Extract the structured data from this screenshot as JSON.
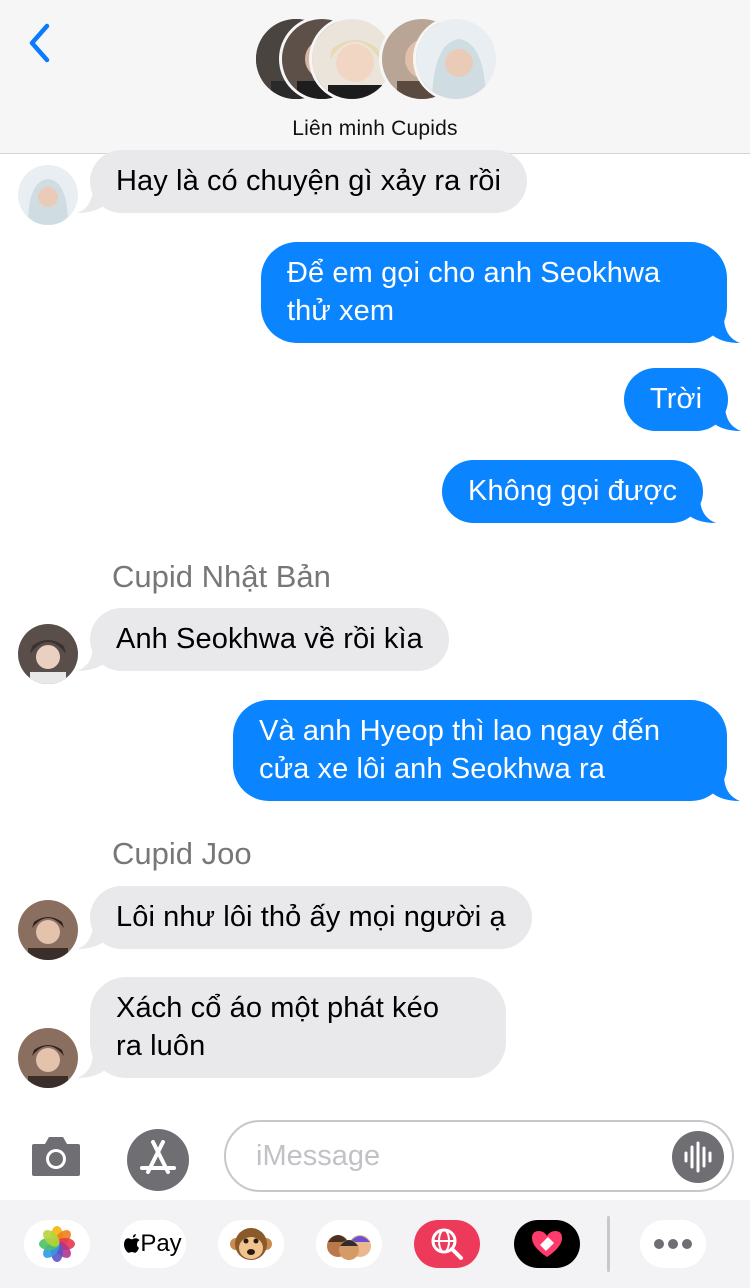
{
  "header": {
    "group_name": "Liên minh Cupids",
    "back_icon": "chevron-left-icon"
  },
  "messages": [
    {
      "side": "received",
      "text": "Hay là có chuyện gì xảy ra rồi"
    },
    {
      "side": "sent",
      "lines": [
        "Để em gọi cho anh Seokhwa",
        "thử xem"
      ]
    },
    {
      "side": "sent",
      "text": "Trời"
    },
    {
      "side": "sent",
      "text": "Không gọi được"
    },
    {
      "side": "received",
      "sender": "Cupid Nhật Bản",
      "text": "Anh Seokhwa về rồi kìa"
    },
    {
      "side": "sent",
      "lines": [
        "Và anh Hyeop thì lao ngay đến",
        "cửa xe lôi anh Seokhwa ra"
      ]
    },
    {
      "side": "received",
      "sender": "Cupid Joo",
      "text": "Lôi như lôi thỏ ấy mọi người ạ"
    },
    {
      "side": "received",
      "lines": [
        "Xách cổ áo một phát kéo",
        "ra luôn"
      ]
    }
  ],
  "input": {
    "placeholder": "iMessage",
    "camera_icon": "camera-icon",
    "appstore_icon": "app-store-icon",
    "voice_icon": "waveform-icon"
  },
  "apps": {
    "photos": "photos-icon",
    "apple_pay": "Pay",
    "animoji": "monkey-icon",
    "memoji": "memoji-icon",
    "search": "globe-search-icon",
    "digital_touch": "heart-icon",
    "more": "more-icon"
  },
  "colors": {
    "sent_bubble": "#0a84ff",
    "received_bubble": "#e9e9eb",
    "accent": "#0a7aff"
  }
}
